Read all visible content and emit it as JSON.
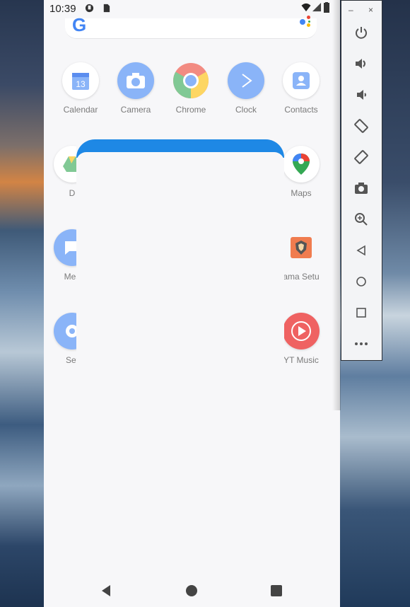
{
  "status_bar": {
    "time": "10:39"
  },
  "search": {
    "logo": "G"
  },
  "apps": {
    "row1": [
      {
        "name": "Calendar",
        "icon": "calendar-icon",
        "badge": "13"
      },
      {
        "name": "Camera",
        "icon": "camera-icon"
      },
      {
        "name": "Chrome",
        "icon": "chrome-icon"
      },
      {
        "name": "Clock",
        "icon": "clock-icon"
      },
      {
        "name": "Contacts",
        "icon": "contacts-icon"
      }
    ],
    "partial_left": [
      {
        "name": "D",
        "icon": "drive-icon"
      },
      {
        "name": "Mes",
        "icon": "messages-icon"
      },
      {
        "name": "Set",
        "icon": "settings-icon"
      }
    ],
    "partial_right": [
      {
        "name": "Maps",
        "icon": "maps-icon"
      },
      {
        "name": "ama Setu",
        "icon": "aarogya-setu-icon"
      },
      {
        "name": "YT Music",
        "icon": "yt-music-icon"
      }
    ]
  },
  "navbar": {
    "back": "back-icon",
    "home": "home-icon",
    "recents": "recents-icon"
  },
  "emulator_panel": {
    "minimize": "–",
    "close": "×",
    "tools": [
      "power-icon",
      "volume-up-icon",
      "volume-down-icon",
      "rotate-left-icon",
      "rotate-right-icon",
      "screenshot-icon",
      "zoom-icon",
      "back-icon",
      "home-icon",
      "overview-icon",
      "more-icon"
    ]
  },
  "colors": {
    "accent_blue": "#1e88e5",
    "panel_bg": "#f3f4f6"
  }
}
